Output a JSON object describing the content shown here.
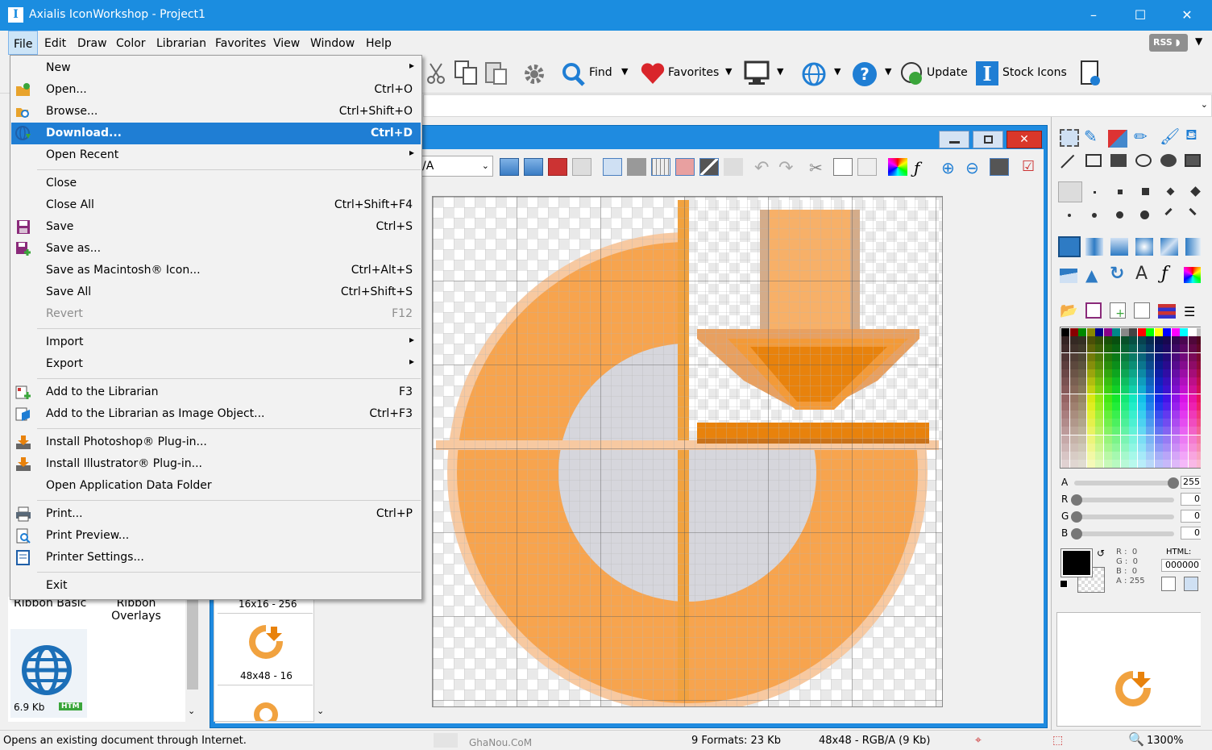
{
  "window": {
    "title": "Axialis IconWorkshop - Project1",
    "min": "–",
    "max": "☐",
    "close": "✕"
  },
  "menubar": [
    "File",
    "Edit",
    "Draw",
    "Color",
    "Librarian",
    "Favorites",
    "View",
    "Window",
    "Help"
  ],
  "rss": "RSS",
  "toolbar": {
    "find": "Find",
    "favorites": "Favorites",
    "update": "Update",
    "stock_icons": "Stock Icons"
  },
  "doc_toolbar": {
    "mode_value": "/A"
  },
  "file_menu": [
    {
      "label": "New",
      "shortcut": "",
      "submenu": true,
      "icon": ""
    },
    {
      "label": "Open...",
      "shortcut": "Ctrl+O",
      "icon": "open-folder-icon"
    },
    {
      "label": "Browse...",
      "shortcut": "Ctrl+Shift+O",
      "icon": "browse-icon"
    },
    {
      "label": "Download...",
      "shortcut": "Ctrl+D",
      "icon": "download-globe-icon",
      "highlighted": true
    },
    {
      "label": "Open Recent",
      "shortcut": "",
      "submenu": true,
      "icon": ""
    },
    {
      "sep": true
    },
    {
      "label": "Close",
      "shortcut": "",
      "icon": ""
    },
    {
      "label": "Close All",
      "shortcut": "Ctrl+Shift+F4",
      "icon": ""
    },
    {
      "label": "Save",
      "shortcut": "Ctrl+S",
      "icon": "save-icon"
    },
    {
      "label": "Save as...",
      "shortcut": "",
      "icon": "save-as-icon"
    },
    {
      "label": "Save as Macintosh® Icon...",
      "shortcut": "Ctrl+Alt+S",
      "icon": ""
    },
    {
      "label": "Save All",
      "shortcut": "Ctrl+Shift+S",
      "icon": ""
    },
    {
      "label": "Revert",
      "shortcut": "F12",
      "icon": "",
      "disabled": true
    },
    {
      "sep": true
    },
    {
      "label": "Import",
      "shortcut": "",
      "submenu": true,
      "icon": ""
    },
    {
      "label": "Export",
      "shortcut": "",
      "submenu": true,
      "icon": ""
    },
    {
      "sep": true
    },
    {
      "label": "Add to the Librarian",
      "shortcut": "F3",
      "icon": "add-librarian-icon"
    },
    {
      "label": "Add to the Librarian as Image Object...",
      "shortcut": "Ctrl+F3",
      "icon": "add-librarian-object-icon"
    },
    {
      "sep": true
    },
    {
      "label": "Install Photoshop® Plug-in...",
      "shortcut": "",
      "icon": "install-plugin-icon"
    },
    {
      "label": "Install Illustrator® Plug-in...",
      "shortcut": "",
      "icon": "install-plugin-icon"
    },
    {
      "label": "Open Application Data Folder",
      "shortcut": "",
      "icon": ""
    },
    {
      "sep": true
    },
    {
      "label": "Print...",
      "shortcut": "Ctrl+P",
      "icon": "print-icon"
    },
    {
      "label": "Print Preview...",
      "shortcut": "",
      "icon": "print-preview-icon"
    },
    {
      "label": "Printer Settings...",
      "shortcut": "",
      "icon": "printer-settings-icon"
    },
    {
      "sep": true
    },
    {
      "label": "Exit",
      "shortcut": "",
      "icon": ""
    }
  ],
  "librarian": {
    "item1": "Ribbon Basic",
    "item2": "Ribbon Overlays",
    "size": "6.9 Kb",
    "badge": "HTM"
  },
  "formats_list": {
    "f1": "16x16 - 256",
    "f2": "48x48 - 16"
  },
  "color_panel": {
    "a_label": "A",
    "r_label": "R",
    "g_label": "G",
    "b_label": "B",
    "a": "255",
    "r": "0",
    "g": "0",
    "b": "0",
    "readout": "R :  0\nG :  0\nB :  0\nA : 255",
    "html_label": "HTML:",
    "html_value": "000000",
    "levels": {
      "a": 1.0,
      "r": 0,
      "g": 0,
      "b": 0
    }
  },
  "statusbar": {
    "message": "Opens an existing document through Internet.",
    "watermark": "GhaNou.CoM",
    "formats": "9 Formats: 23 Kb",
    "image_info": "48x48 - RGB/A (9 Kb)",
    "zoom": "1300%"
  },
  "colors": {
    "accent": "#1f7ed4",
    "icon_orange": "#f7a44e",
    "icon_dark_orange": "#e8820c",
    "icon_gray": "#d6d6dc"
  }
}
